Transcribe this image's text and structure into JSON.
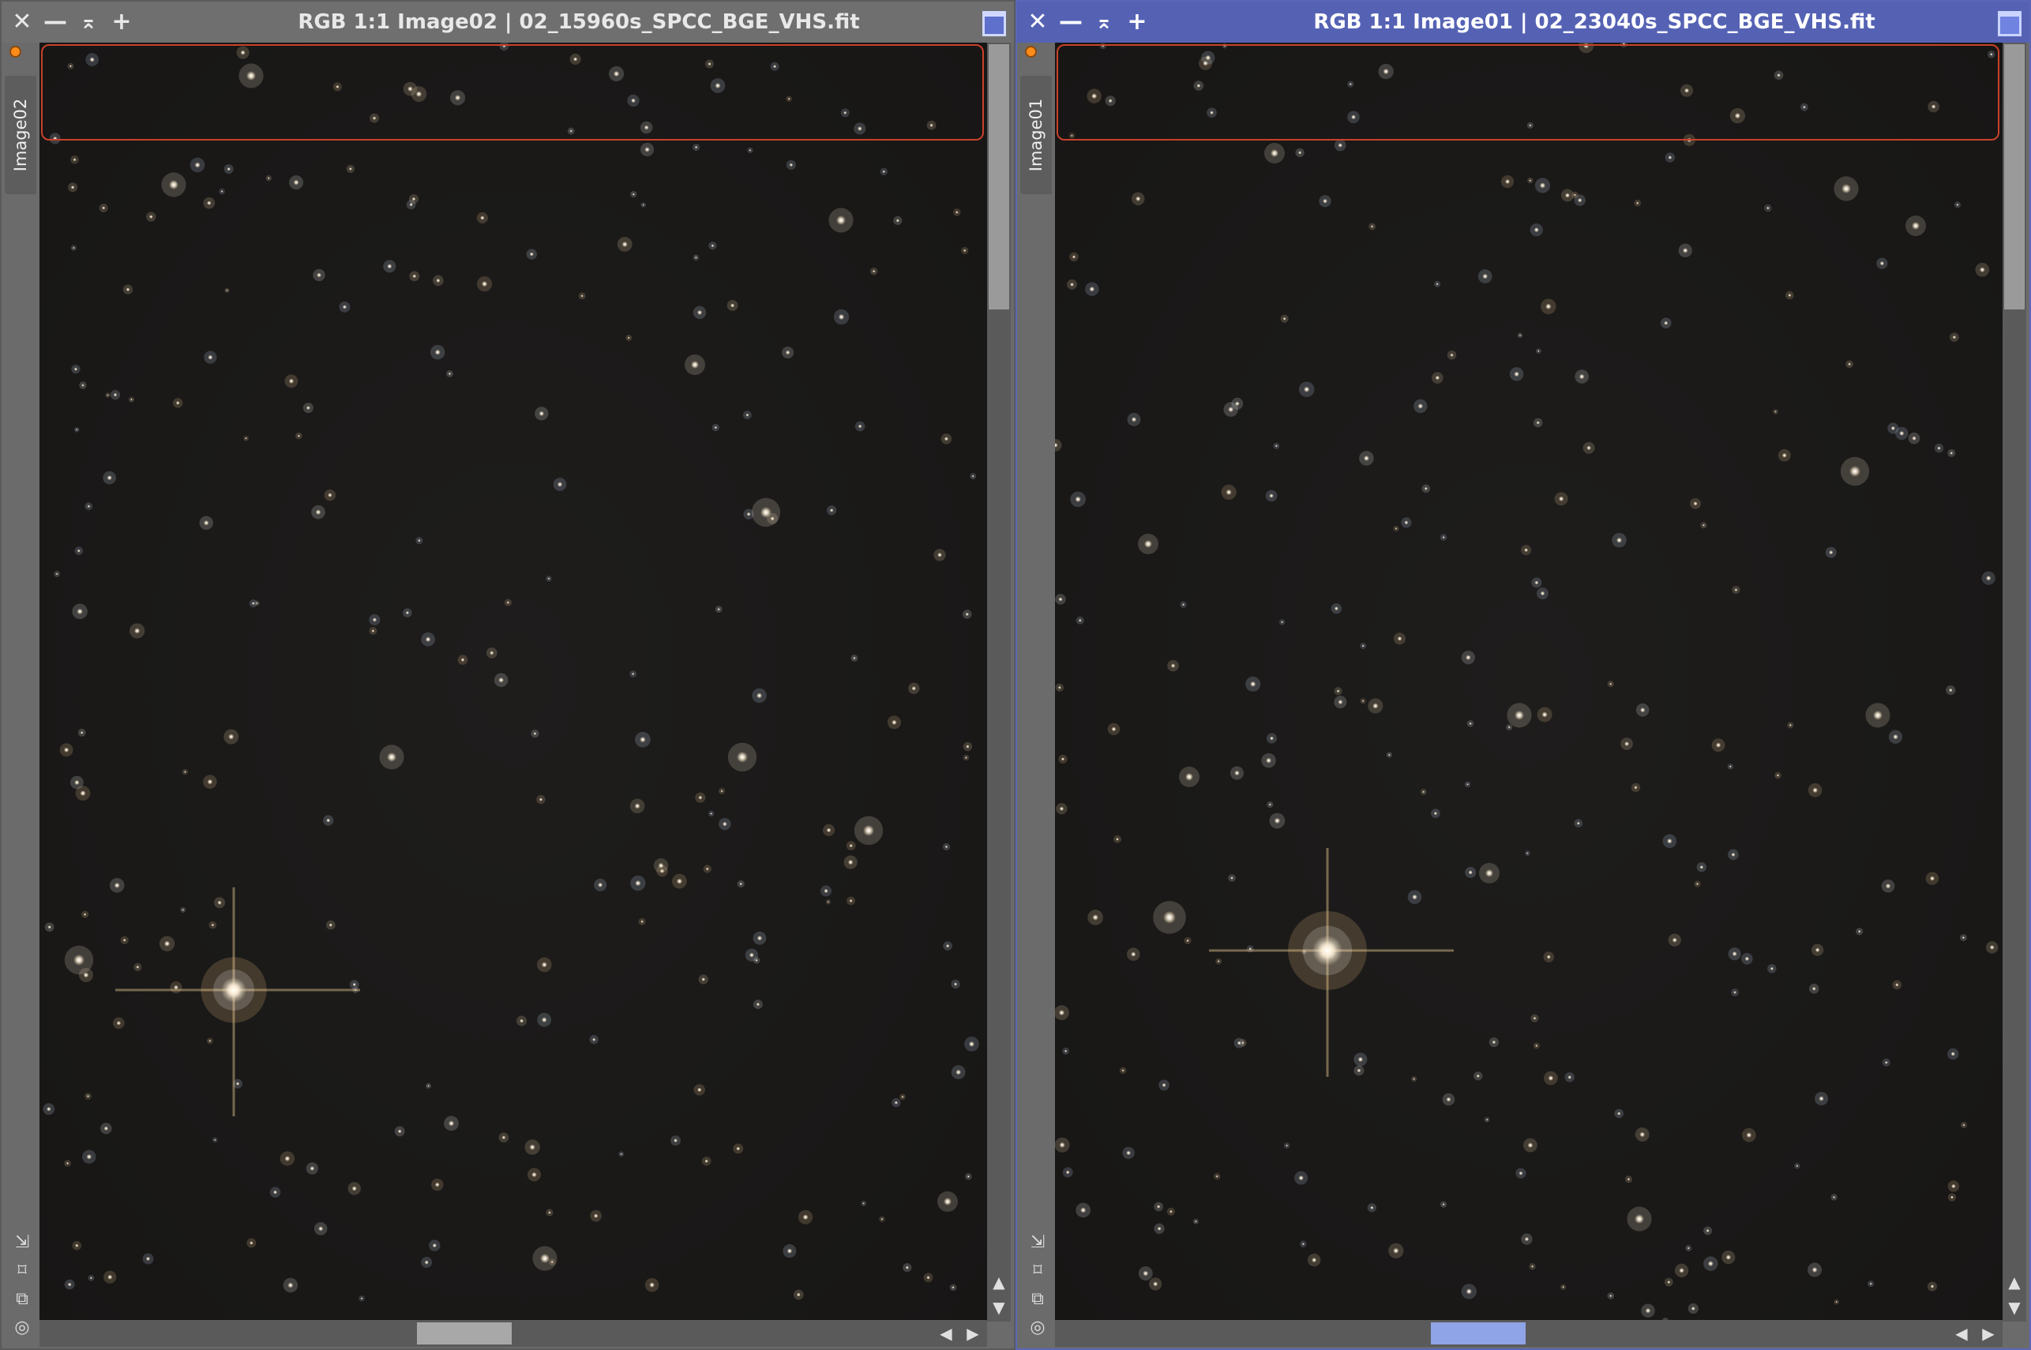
{
  "windows": [
    {
      "title": "RGB 1:1 Image02 | 02_15960s_SPCC_BGE_VHS.fit",
      "tab_label": "Image02",
      "active": false
    },
    {
      "title": "RGB 1:1 Image01 | 02_23040s_SPCC_BGE_VHS.fit",
      "tab_label": "Image01",
      "active": true
    }
  ],
  "titlebar_icons": [
    "close-icon",
    "minimize-icon",
    "shade-icon",
    "maximize-icon",
    "window-icon"
  ],
  "side_tools": [
    "resize-icon",
    "zoom-fit-icon",
    "clone-icon",
    "target-icon"
  ],
  "symbols": {
    "close": "✕",
    "minimize": "—",
    "shade": "⌅",
    "maximize": "+",
    "tool_resize": "⇲",
    "tool_fit": "⌑",
    "tool_clone": "⧉",
    "tool_target": "◎",
    "scroll_up": "▲",
    "scroll_down": "▼",
    "scroll_left": "◀",
    "scroll_right": "▶"
  },
  "colors": {
    "active_titlebar": "#5562b4",
    "inactive_titlebar": "#6f6f6f",
    "preview_rect": "#c8422a",
    "sky_background": "#1a1918"
  }
}
